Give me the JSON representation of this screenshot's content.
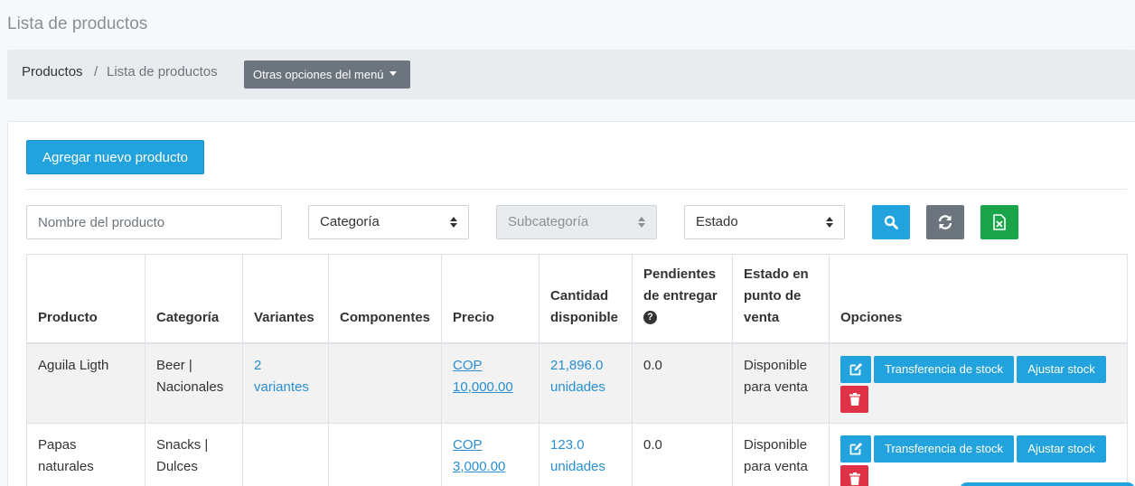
{
  "page": {
    "title": "Lista de productos"
  },
  "breadcrumb": {
    "items": [
      "Productos",
      "Lista de productos"
    ],
    "separator": "/"
  },
  "menu": {
    "label": "Otras opciones del menú"
  },
  "actions": {
    "add_label": "Agregar nuevo producto"
  },
  "filters": {
    "name_placeholder": "Nombre del producto",
    "category_label": "Categoría",
    "subcategory_label": "Subcategoría",
    "status_label": "Estado"
  },
  "table": {
    "headers": {
      "producto": "Producto",
      "categoria": "Categoría",
      "variantes": "Variantes",
      "componentes": "Componentes",
      "precio": "Precio",
      "cantidad": "Cantidad disponible",
      "pendientes": "Pendientes de entregar",
      "estado": "Estado en punto de venta",
      "opciones": "Opciones"
    },
    "rows": [
      {
        "producto": "Aguila Ligth",
        "categoria": "Beer | Nacionales",
        "variantes": "2 variantes",
        "componentes": "",
        "precio": "COP 10,000.00",
        "cantidad": "21,896.0 unidades",
        "pendientes": "0.0",
        "estado": "Disponible para venta"
      },
      {
        "producto": "Papas naturales",
        "categoria": "Snacks | Dulces",
        "variantes": "",
        "componentes": "",
        "precio": "COP 3,000.00",
        "cantidad": "123.0 unidades",
        "pendientes": "0.0",
        "estado": "Disponible para venta"
      }
    ],
    "row_actions": {
      "transfer_label": "Transferencia de stock",
      "adjust_label": "Ajustar stock"
    }
  },
  "icons": {
    "edit": "edit-icon",
    "delete": "trash-icon",
    "search": "search-icon",
    "refresh": "refresh-icon",
    "excel": "excel-icon",
    "help": "question-circle-icon",
    "caret": "caret-down-icon"
  },
  "colors": {
    "primary": "#23a3dd",
    "secondary": "#6c757d",
    "success": "#1aa54a",
    "danger": "#e03246",
    "link": "#2a8fd0"
  }
}
